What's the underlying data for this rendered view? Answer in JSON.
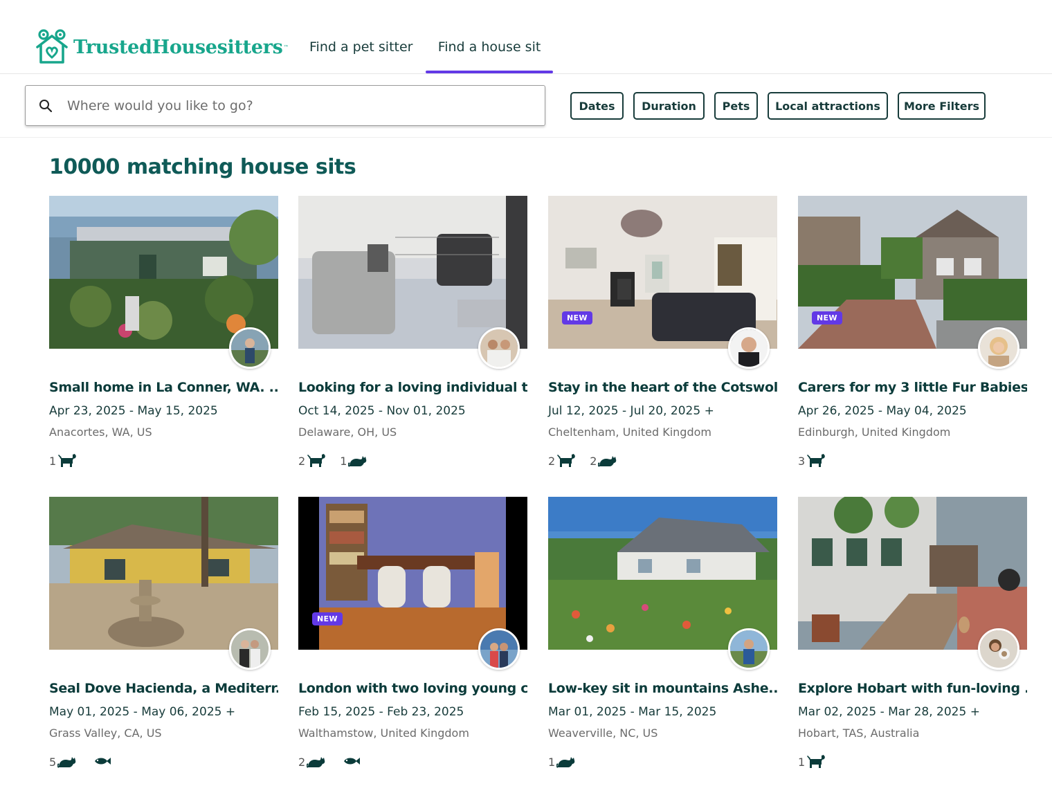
{
  "header": {
    "logo_text": "TrustedHousesitters",
    "logo_tm": "™",
    "nav": [
      "Find a pet sitter",
      "Find a house sit"
    ],
    "active_nav": "Find a house sit"
  },
  "search": {
    "placeholder": "Where would you like to go?",
    "value": ""
  },
  "filters": [
    "Dates",
    "Duration",
    "Pets",
    "Local attractions",
    "More Filters"
  ],
  "main": {
    "heading": "10000 matching house sits"
  },
  "listings": [
    {
      "title": "Small home in La Conner, WA. ...",
      "dates": "Apr 23, 2025 - May 15, 2025",
      "location": "Anacortes, WA, US",
      "is_new": false,
      "badge": "",
      "pets": [
        {
          "count": "1",
          "type": "dog-icon"
        }
      ]
    },
    {
      "title": "Looking for a loving individual t...",
      "dates": "Oct 14, 2025 - Nov 01, 2025",
      "location": "Delaware, OH, US",
      "is_new": false,
      "badge": "",
      "pets": [
        {
          "count": "2",
          "type": "dog-icon"
        },
        {
          "count": "1",
          "type": "cat-icon"
        }
      ]
    },
    {
      "title": "Stay in the heart of the Cotswol...",
      "dates": "Jul 12, 2025 - Jul 20, 2025 +",
      "location": "Cheltenham, United Kingdom",
      "is_new": true,
      "badge": "NEW",
      "pets": [
        {
          "count": "2",
          "type": "dog-icon"
        },
        {
          "count": "2",
          "type": "cat-icon"
        }
      ]
    },
    {
      "title": "Carers for my 3 little Fur Babies",
      "dates": "Apr 26, 2025 - May 04, 2025",
      "location": "Edinburgh, United Kingdom",
      "is_new": true,
      "badge": "NEW",
      "pets": [
        {
          "count": "3",
          "type": "dog-icon"
        }
      ]
    },
    {
      "title": "Seal Dove Hacienda, a Mediterr...",
      "dates": "May 01, 2025 - May 06, 2025 +",
      "location": "Grass Valley, CA, US",
      "is_new": false,
      "badge": "",
      "pets": [
        {
          "count": "5",
          "type": "cat-icon"
        },
        {
          "count": "",
          "type": "fish-icon"
        }
      ]
    },
    {
      "title": "London with two loving young c...",
      "dates": "Feb 15, 2025 - Feb 23, 2025",
      "location": "Walthamstow, United Kingdom",
      "is_new": true,
      "badge": "NEW",
      "pets": [
        {
          "count": "2",
          "type": "cat-icon"
        },
        {
          "count": "",
          "type": "fish-icon"
        }
      ]
    },
    {
      "title": "Low-key sit in mountains Ashe...",
      "dates": "Mar 01, 2025 - Mar 15, 2025",
      "location": "Weaverville, NC, US",
      "is_new": false,
      "badge": "",
      "pets": [
        {
          "count": "1",
          "type": "cat-icon"
        }
      ]
    },
    {
      "title": "Explore Hobart with fun-loving ...",
      "dates": "Mar 02, 2025 - Mar 28, 2025 +",
      "location": "Hobart, TAS, Australia",
      "is_new": false,
      "badge": "",
      "pets": [
        {
          "count": "1",
          "type": "dog-icon"
        }
      ]
    }
  ],
  "colors": {
    "brand": "#18a68c",
    "accent": "#6239e6",
    "text_dark": "#0b3b3a",
    "heading": "#0f5a57"
  }
}
